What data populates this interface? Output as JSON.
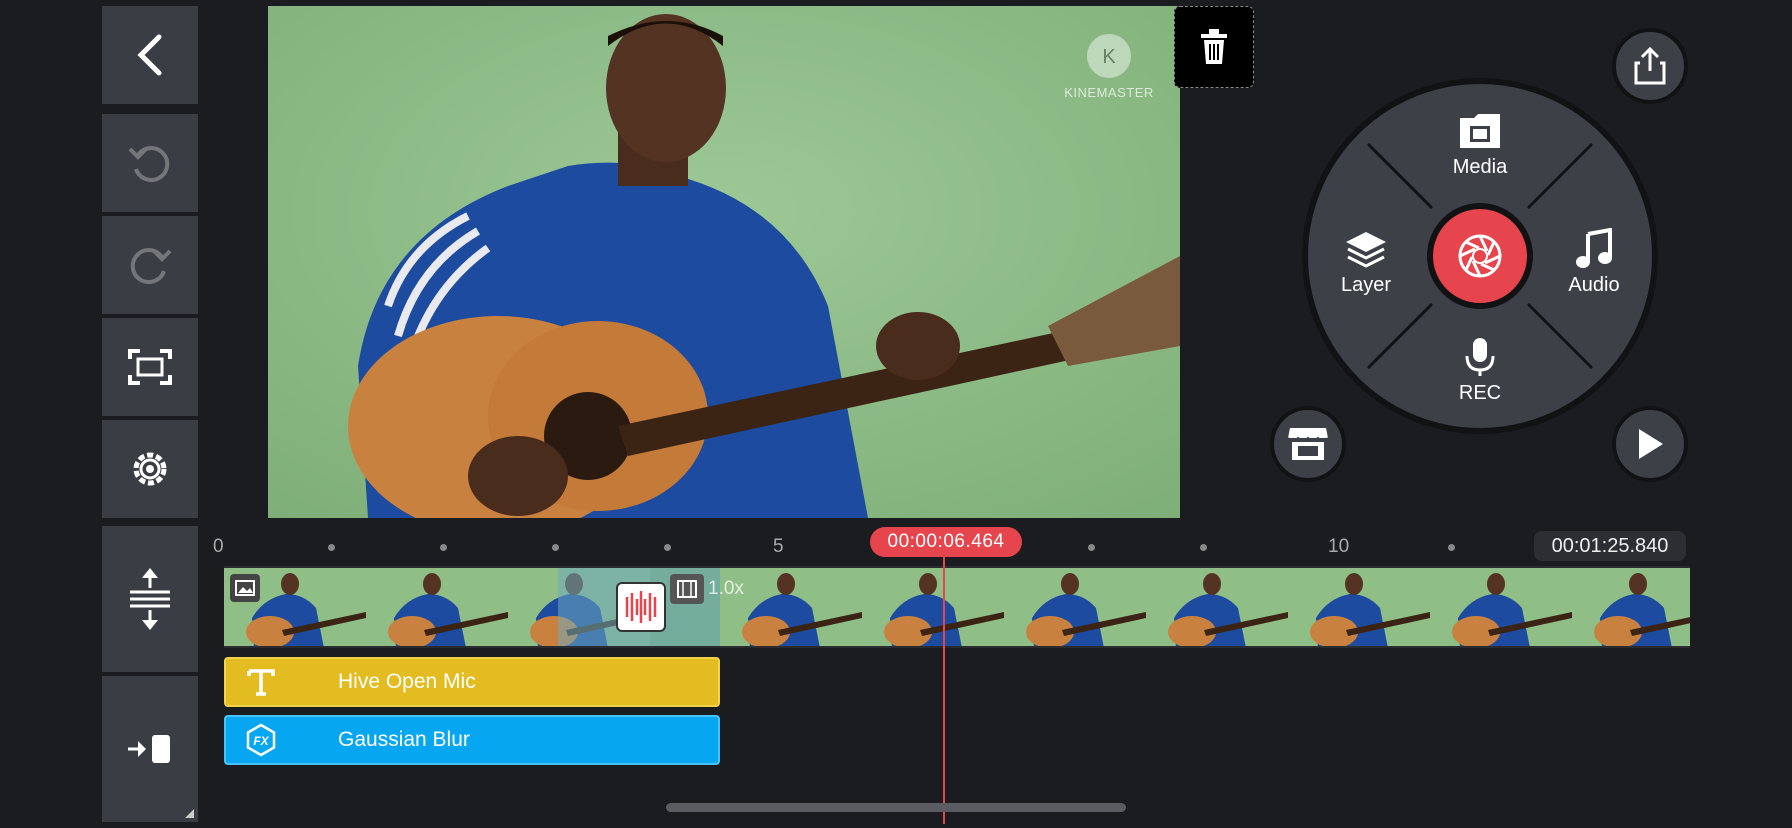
{
  "app": "KineMaster",
  "preview": {
    "watermark": "KINEMASTER"
  },
  "menu": {
    "media": "Media",
    "layer": "Layer",
    "audio": "Audio",
    "rec": "REC"
  },
  "timeline": {
    "ticks": [
      "0",
      "5",
      "10"
    ],
    "current_time": "00:00:06.464",
    "duration": "00:01:25.840",
    "speed": "1.0x"
  },
  "tracks": {
    "text_clip": "Hive Open Mic",
    "fx_clip": "Gaussian Blur"
  },
  "colors": {
    "accent": "#e6454e",
    "text_clip": "#e3bc21",
    "fx_clip": "#06a7f0",
    "panel": "#3b3d44"
  }
}
